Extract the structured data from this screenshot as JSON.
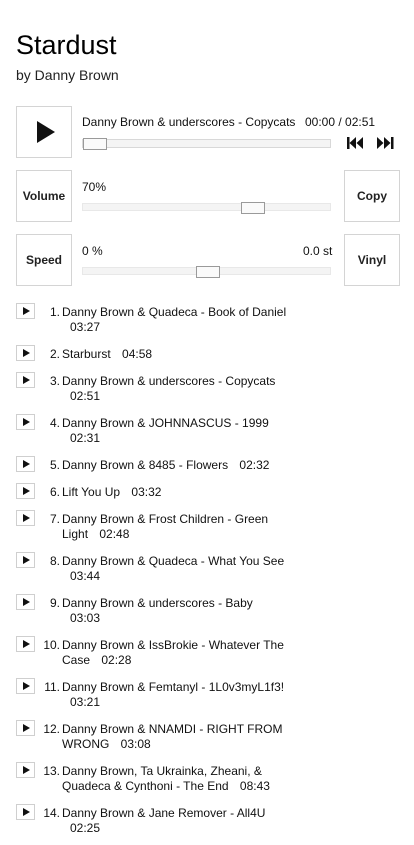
{
  "album": {
    "title": "Stardust",
    "artist": "by Danny Brown"
  },
  "player": {
    "now_playing": "Danny Brown & underscores - Copycats",
    "time": "00:00 / 02:51",
    "progress": 0
  },
  "controls": {
    "volume_label": "Volume",
    "volume_value": "70%",
    "volume_level": 0.7,
    "speed_label": "Speed",
    "speed_value": "0 %",
    "semitone_value": "0.0 st",
    "speed_level": 0.5,
    "copy_label": "Copy",
    "vinyl_label": "Vinyl"
  },
  "icons": {
    "play": "play-icon",
    "prev": "skip-previous-icon",
    "next": "skip-next-icon"
  },
  "tracks": [
    {
      "num": "1.",
      "title": "Danny Brown & Quadeca - Book of Daniel",
      "duration": "03:27"
    },
    {
      "num": "2.",
      "title": "Starburst",
      "duration": "04:58"
    },
    {
      "num": "3.",
      "title": "Danny Brown & underscores - Copycats",
      "duration": "02:51"
    },
    {
      "num": "4.",
      "title": "Danny Brown & JOHNNASCUS - 1999",
      "duration": "02:31"
    },
    {
      "num": "5.",
      "title": "Danny Brown & 8485 - Flowers",
      "duration": "02:32"
    },
    {
      "num": "6.",
      "title": "Lift You Up",
      "duration": "03:32"
    },
    {
      "num": "7.",
      "title": "Danny Brown & Frost Children - Green Light",
      "duration": "02:48"
    },
    {
      "num": "8.",
      "title": "Danny Brown & Quadeca - What You See",
      "duration": "03:44"
    },
    {
      "num": "9.",
      "title": "Danny Brown & underscores - Baby",
      "duration": "03:03"
    },
    {
      "num": "10.",
      "title": "Danny Brown & IssBrokie - Whatever The Case",
      "duration": "02:28"
    },
    {
      "num": "11.",
      "title": "Danny Brown & Femtanyl - 1L0v3myL1f3!",
      "duration": "03:21"
    },
    {
      "num": "12.",
      "title": "Danny Brown & NNAMDI - RIGHT FROM WRONG",
      "duration": "03:08"
    },
    {
      "num": "13.",
      "title": "Danny Brown, Ta Ukrainka, Zheani, & Quadeca & Cynthoni - The End",
      "duration": "08:43"
    },
    {
      "num": "14.",
      "title": "Danny Brown & Jane Remover - All4U",
      "duration": "02:25"
    }
  ]
}
